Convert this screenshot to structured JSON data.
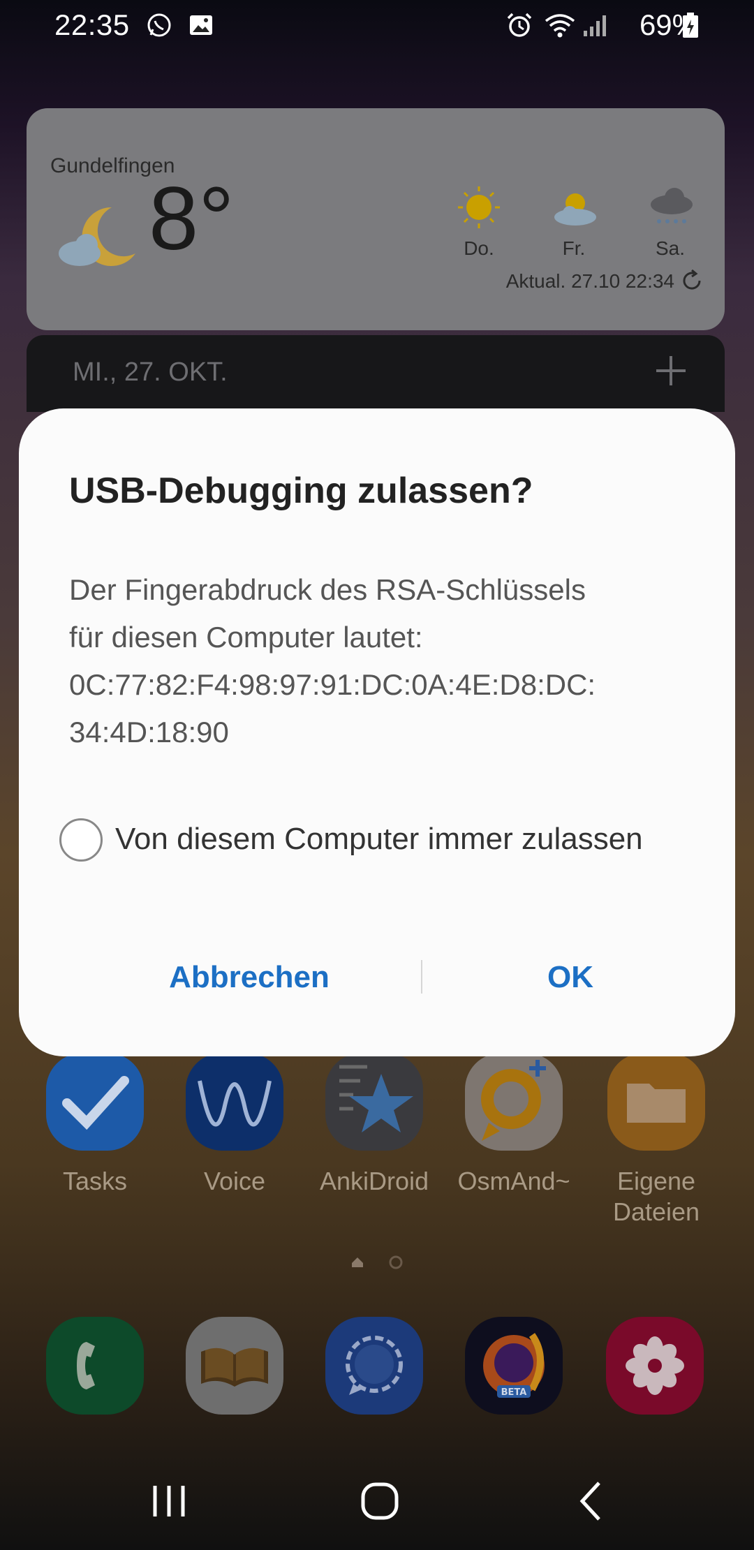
{
  "status_bar": {
    "time": "22:35",
    "battery": "69%",
    "icons": [
      "whatsapp-icon",
      "image-icon",
      "alarm-icon",
      "wifi-icon",
      "signal-icon",
      "battery-icon"
    ]
  },
  "weather": {
    "city": "Gundelfingen",
    "temperature": "8°",
    "forecast": [
      {
        "day": "Do.",
        "icon": "sun-icon"
      },
      {
        "day": "Fr.",
        "icon": "partly-cloudy-icon"
      },
      {
        "day": "Sa.",
        "icon": "rain-icon"
      }
    ],
    "updated": "Aktual. 27.10 22:34"
  },
  "calendar": {
    "date": "MI., 27. OKT."
  },
  "dialog": {
    "title": "USB-Debugging zulassen?",
    "body_lines": [
      "Der Fingerabdruck des RSA-Schlüssels",
      "für diesen Computer lautet:",
      "0C:77:82:F4:98:97:91:DC:0A:4E:D8:DC:",
      "34:4D:18:90"
    ],
    "checkbox_label": "Von diesem Computer immer zulassen",
    "checkbox_checked": false,
    "cancel_label": "Abbrechen",
    "ok_label": "OK",
    "accent_color": "#1c6fc4"
  },
  "apps": [
    {
      "label": "Tasks",
      "icon": "tasks-icon"
    },
    {
      "label": "Voice",
      "icon": "voice-icon"
    },
    {
      "label": "AnkiDroid",
      "icon": "ankidroid-icon"
    },
    {
      "label": "OsmAnd~",
      "icon": "osmand-icon"
    },
    {
      "label": "Eigene Dateien",
      "icon": "folder-icon"
    }
  ],
  "dock": [
    {
      "icon": "phone-icon"
    },
    {
      "icon": "book-icon"
    },
    {
      "icon": "signal-messenger-icon"
    },
    {
      "icon": "firefox-beta-icon",
      "badge": "BETA"
    },
    {
      "icon": "flower-app-icon"
    }
  ],
  "page_indicator": {
    "pages": 2,
    "current": 1
  }
}
